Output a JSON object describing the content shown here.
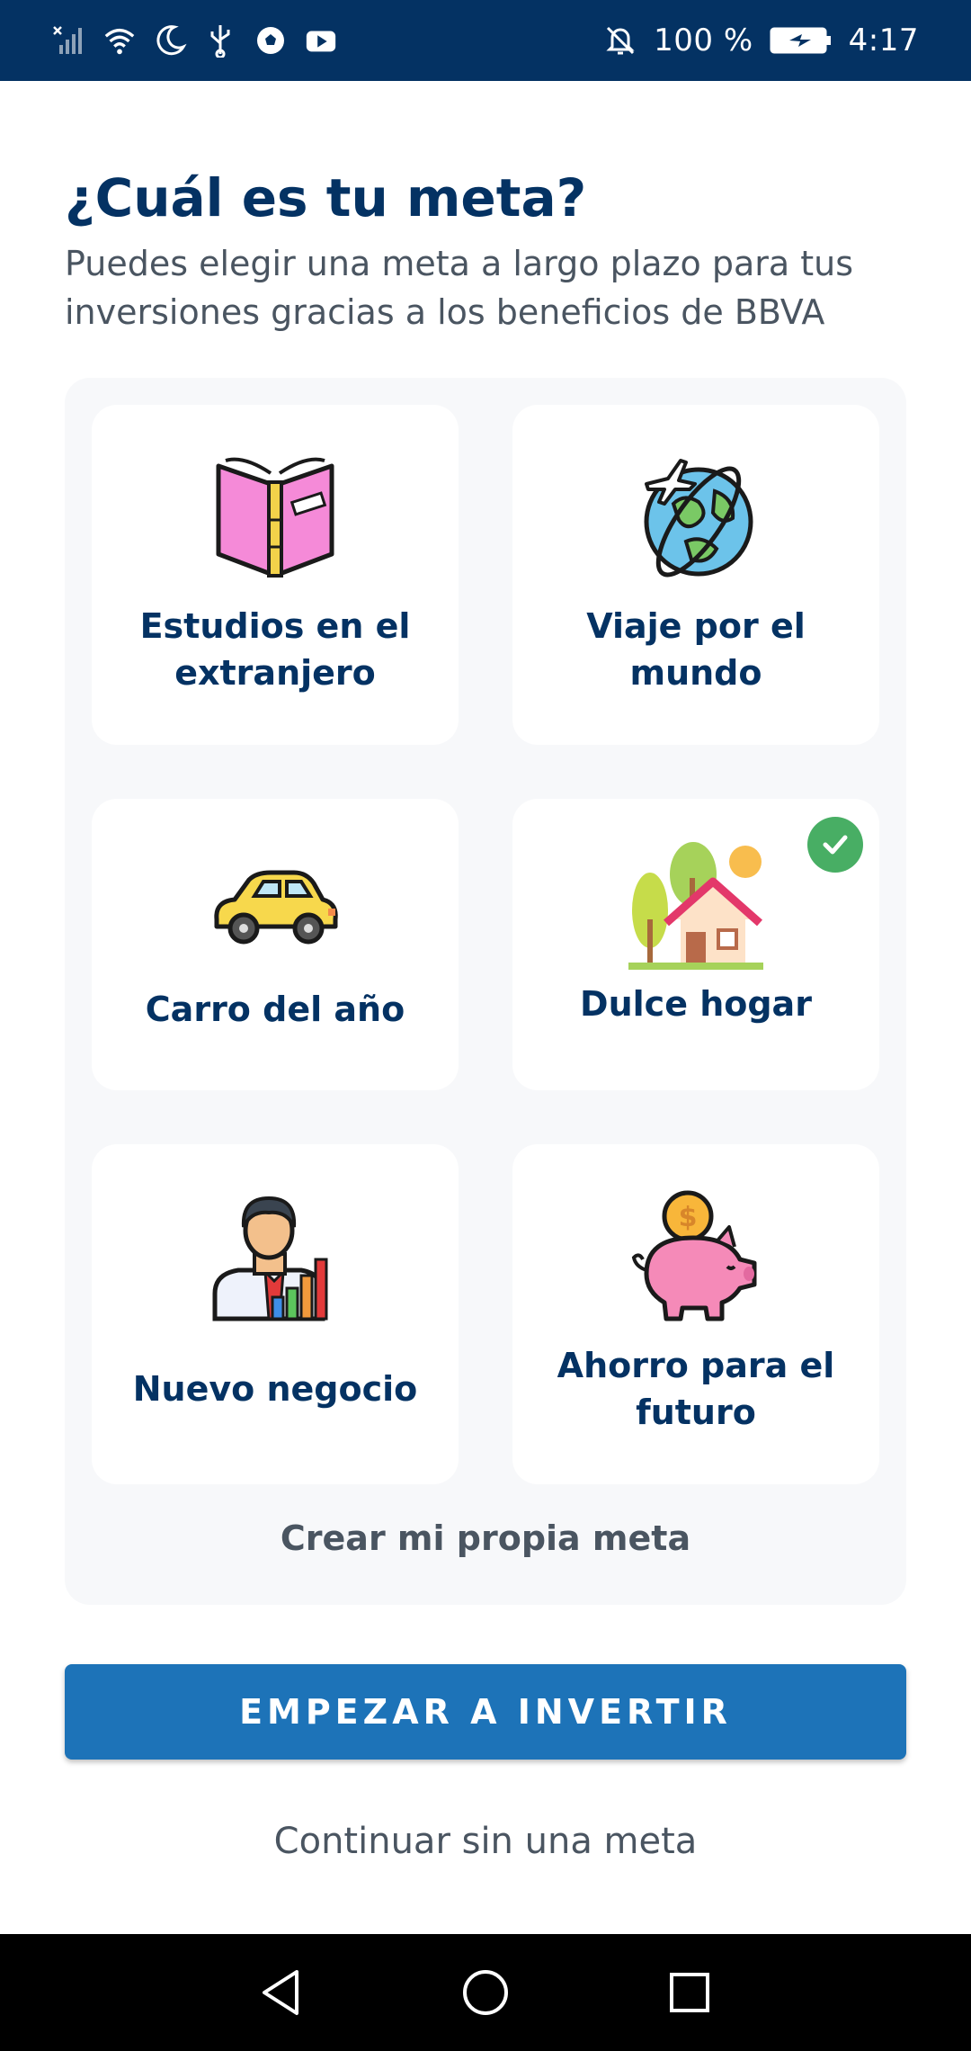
{
  "status_bar": {
    "battery_text": "100 %",
    "time": "4:17",
    "left_icons": [
      "no-signal-icon",
      "wifi-icon",
      "do-not-disturb-moon-icon",
      "usb-icon",
      "soccer-app-icon",
      "youtube-icon"
    ],
    "right_icons": [
      "notifications-off-icon",
      "battery-charging-icon"
    ]
  },
  "header": {
    "title": "¿Cuál es tu meta?",
    "subtitle": "Puedes elegir una meta a largo plazo para tus inversiones gracias a los beneficios de BBVA"
  },
  "goals": [
    {
      "label": "Estudios en el extranjero",
      "icon": "book-icon",
      "selected": false
    },
    {
      "label": "Viaje por el mundo",
      "icon": "globe-plane-icon",
      "selected": false
    },
    {
      "label": "Carro del año",
      "icon": "car-icon",
      "selected": false
    },
    {
      "label": "Dulce hogar",
      "icon": "house-icon",
      "selected": true
    },
    {
      "label": "Nuevo negocio",
      "icon": "businessman-chart-icon",
      "selected": false
    },
    {
      "label": "Ahorro para el futuro",
      "icon": "piggy-bank-icon",
      "selected": false
    }
  ],
  "create_goal_label": "Crear mi propia meta",
  "cta_label": "EMPEZAR A INVERTIR",
  "skip_label": "Continuar sin una meta",
  "colors": {
    "brand_navy": "#043263",
    "primary_button": "#1d73b8",
    "check_green": "#48ae64",
    "panel_bg": "#f7f8fa",
    "muted_text": "#4a5561"
  },
  "nav_bar": [
    "back-icon",
    "home-icon",
    "recents-icon"
  ]
}
